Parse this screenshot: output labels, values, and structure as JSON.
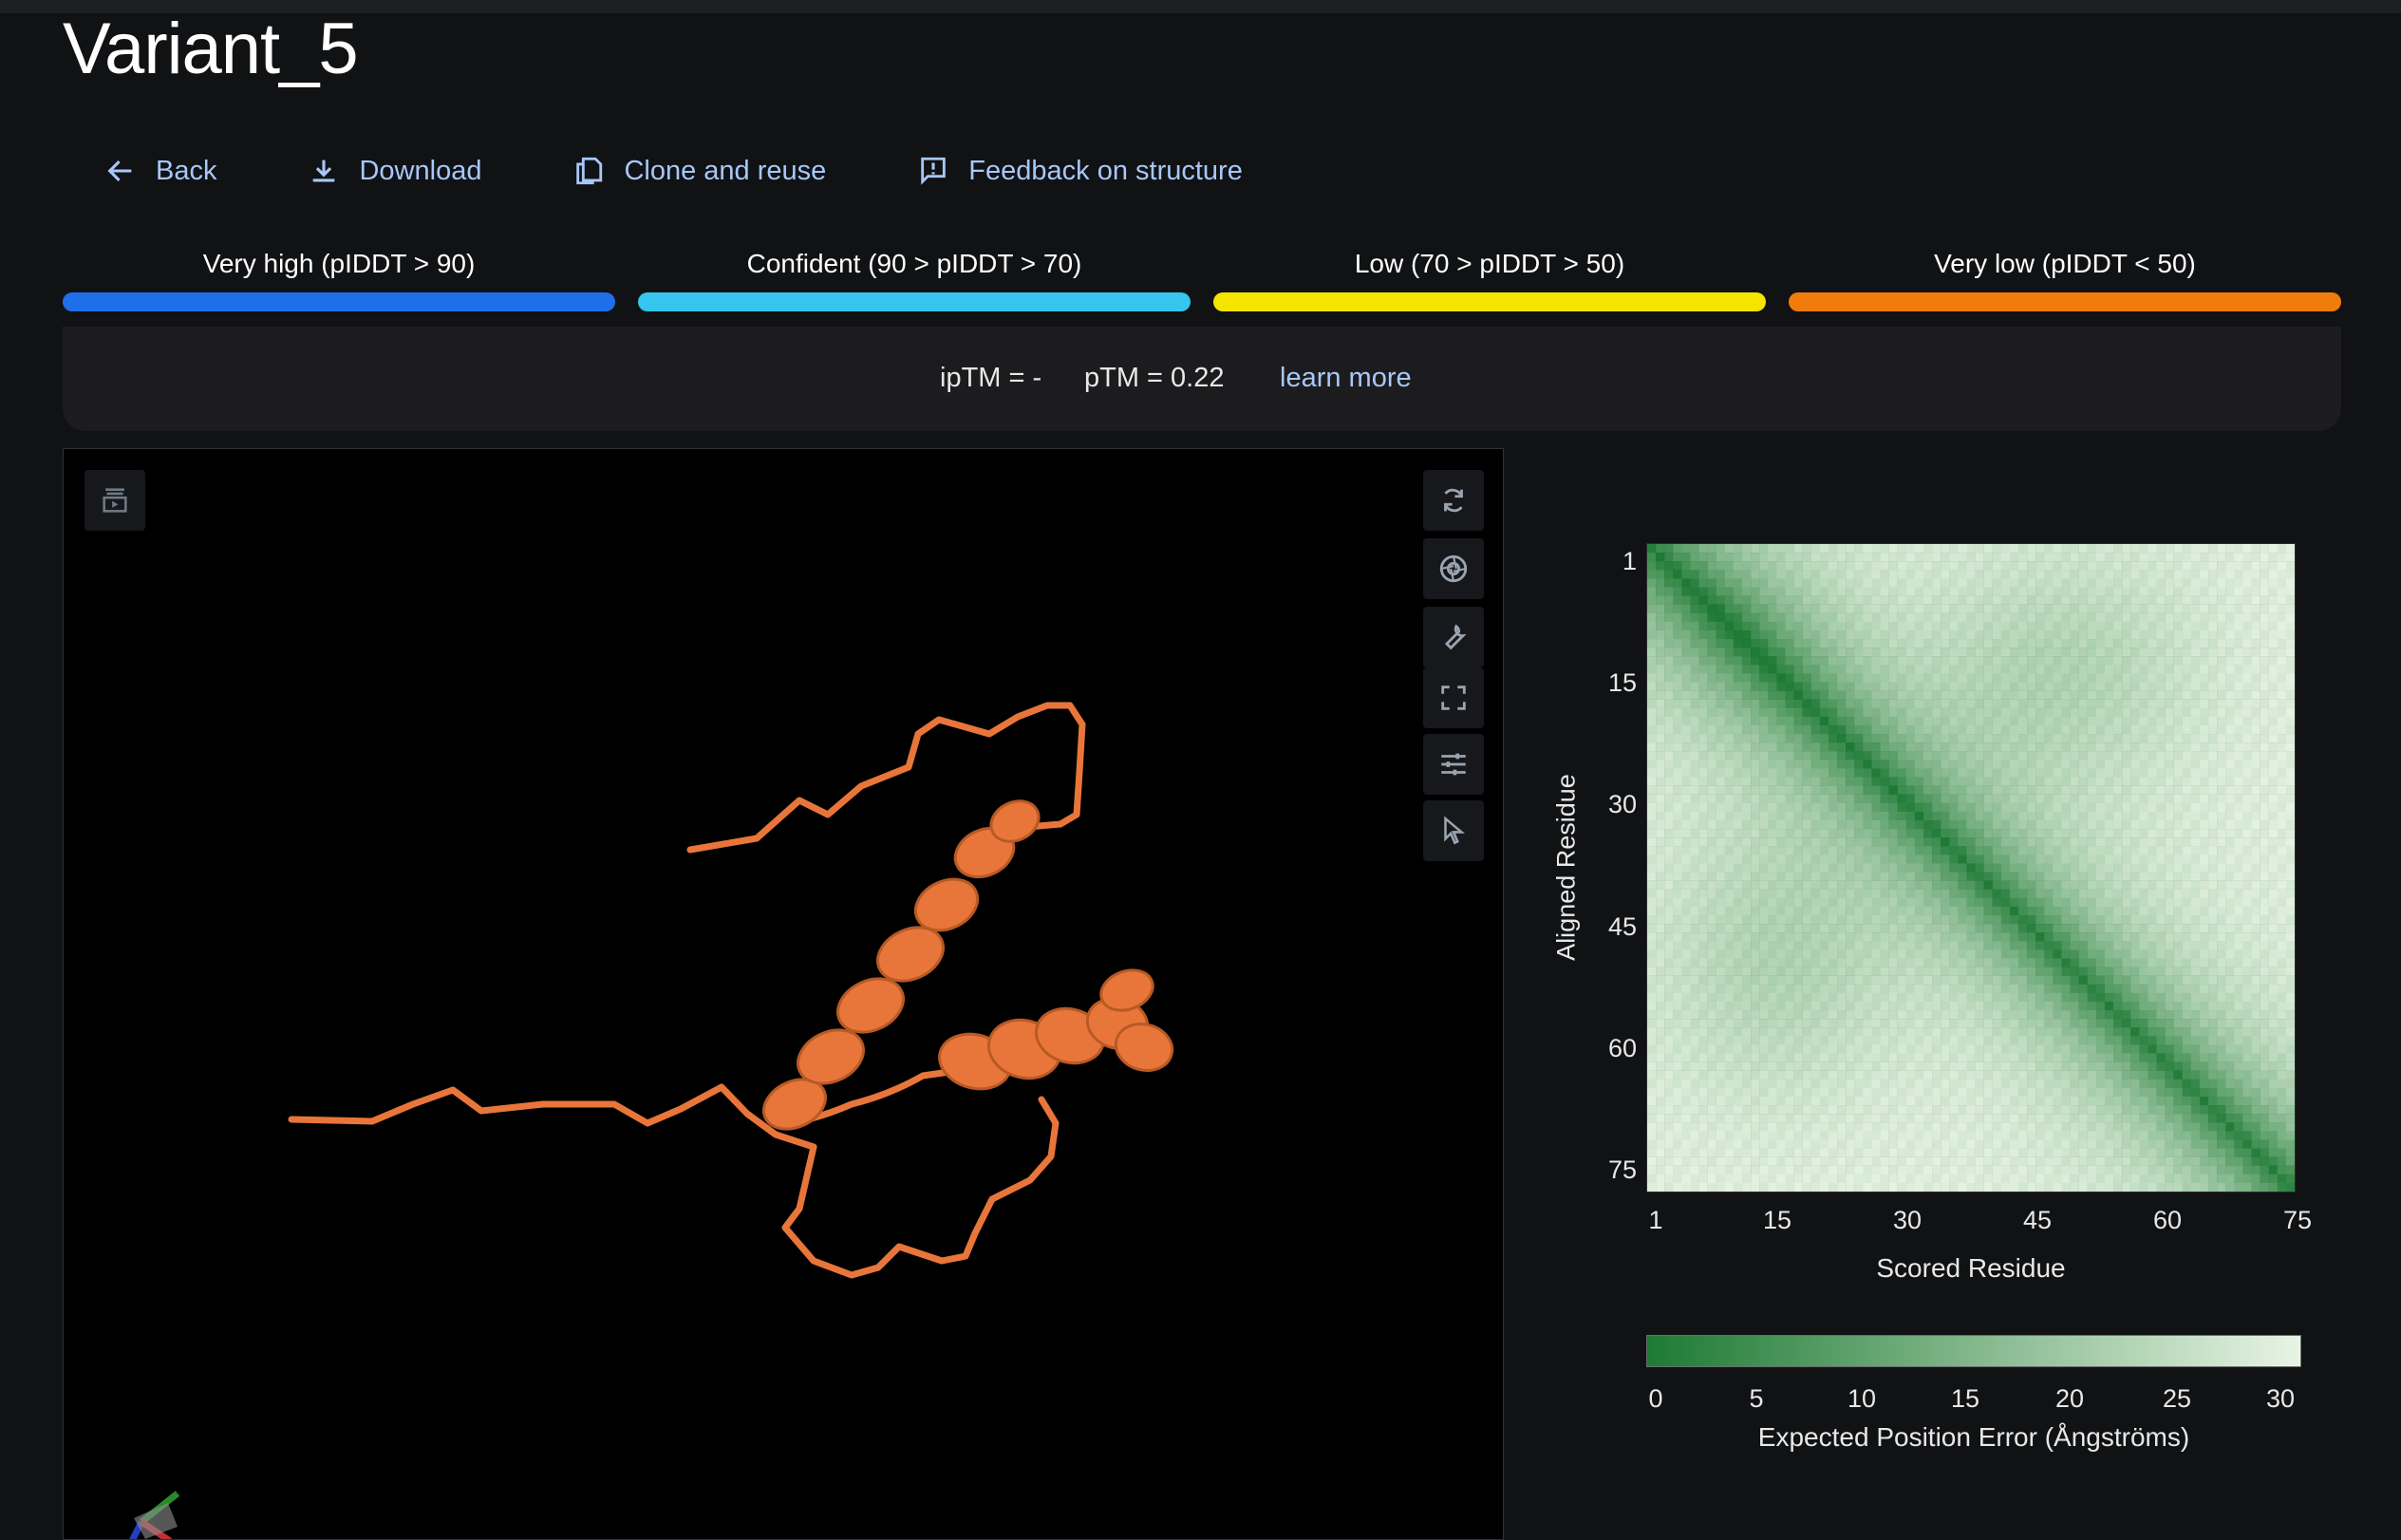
{
  "page": {
    "title": "Variant_5"
  },
  "actions": [
    {
      "label": "Back",
      "icon": "arrow-left-icon"
    },
    {
      "label": "Download",
      "icon": "download-icon"
    },
    {
      "label": "Clone and reuse",
      "icon": "copy-icon"
    },
    {
      "label": "Feedback on structure",
      "icon": "feedback-icon"
    }
  ],
  "legend": [
    {
      "label": "Very high (pIDDT > 90)",
      "color": "#1f6feb"
    },
    {
      "label": "Confident (90 > pIDDT > 70)",
      "color": "#35c5ee"
    },
    {
      "label": "Low (70 > pIDDT > 50)",
      "color": "#f5e400"
    },
    {
      "label": "Very low (pIDDT < 50)",
      "color": "#f07c0c"
    }
  ],
  "scores": {
    "iptm": "ipTM = -",
    "ptm": "pTM = 0.22",
    "learn_more": "learn more"
  },
  "viewer": {
    "structure_color": "#e8763a",
    "left_buttons": [
      "animation-icon"
    ],
    "right_buttons": [
      "reset-camera-icon",
      "screenshot-icon",
      "tools-icon",
      "fullscreen-icon",
      "settings-sliders-icon",
      "select-cursor-icon"
    ]
  },
  "chart_data": {
    "type": "heatmap",
    "title": "",
    "xlabel": "Scored Residue",
    "ylabel": "Aligned Residue",
    "x_ticks": [
      "1",
      "15",
      "30",
      "45",
      "60",
      "75"
    ],
    "y_ticks": [
      "1",
      "15",
      "30",
      "45",
      "60",
      "75"
    ],
    "n_residues": 75,
    "colorbar": {
      "label": "Expected Position Error (Ångströms)",
      "ticks": [
        "0",
        "5",
        "10",
        "15",
        "20",
        "25",
        "30"
      ],
      "range": [
        0,
        31
      ],
      "color_low": "#1e7a34",
      "color_high": "#e8f4e4"
    }
  }
}
